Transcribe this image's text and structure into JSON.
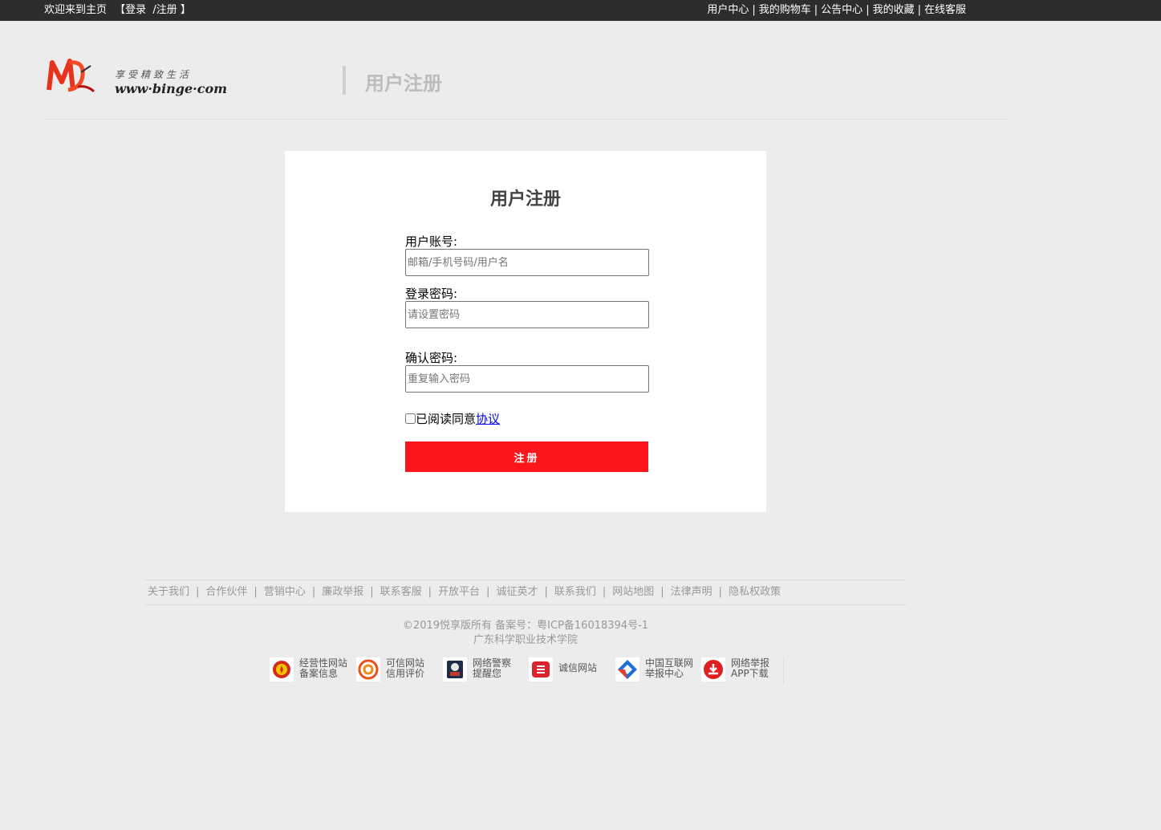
{
  "topbar": {
    "welcome": "欢迎来到主页",
    "bracket_open": "【",
    "login": "登录",
    "slash": "/",
    "register": "注册",
    "bracket_close": "】",
    "links": [
      "用户中心",
      "我的购物车",
      "公告中心",
      "我的收藏",
      "在线客服"
    ],
    "separator": "|"
  },
  "header": {
    "logo_slogan": "享受精致生活",
    "logo_url": "www·binge·com",
    "title": "用户注册"
  },
  "form": {
    "title": "用户注册",
    "account_label": "用户账号:",
    "account_placeholder": "邮箱/手机号码/用户名",
    "password_label": "登录密码:",
    "password_placeholder": "请设置密码",
    "confirm_label": "确认密码:",
    "confirm_placeholder": "重复输入密码",
    "agree_text": "已阅读同意",
    "agree_link": "协议",
    "submit_label": "注册"
  },
  "footer": {
    "links": [
      "关于我们",
      "合作伙伴",
      "营销中心",
      "廉政举报",
      "联系客服",
      "开放平台",
      "诚征英才",
      "联系我们",
      "网站地图",
      "法律声明",
      "隐私权政策"
    ],
    "separator": "|",
    "copyright": "©2019悦享版所有 备案号：粤ICP备16018394号-1",
    "school": "广东科学职业技术学院",
    "badges": [
      {
        "icon": "emblem-icon",
        "line1": "经营性网站",
        "line2": "备案信息"
      },
      {
        "icon": "trust-rating-icon",
        "line1": "可信网站",
        "line2": "信用评价"
      },
      {
        "icon": "police-icon",
        "line1": "网络警察",
        "line2": "提醒您"
      },
      {
        "icon": "integrity-icon",
        "line1": "诚信网站",
        "line2": ""
      },
      {
        "icon": "report-center-icon",
        "line1": "中国互联网",
        "line2": "举报中心"
      },
      {
        "icon": "download-icon",
        "line1": "网络举报",
        "line2": "APP下载"
      }
    ]
  },
  "colors": {
    "topbar_bg": "#2d2d2d",
    "page_bg": "#ececec",
    "primary_red": "#fc161c",
    "link_blue": "#0000ee"
  }
}
